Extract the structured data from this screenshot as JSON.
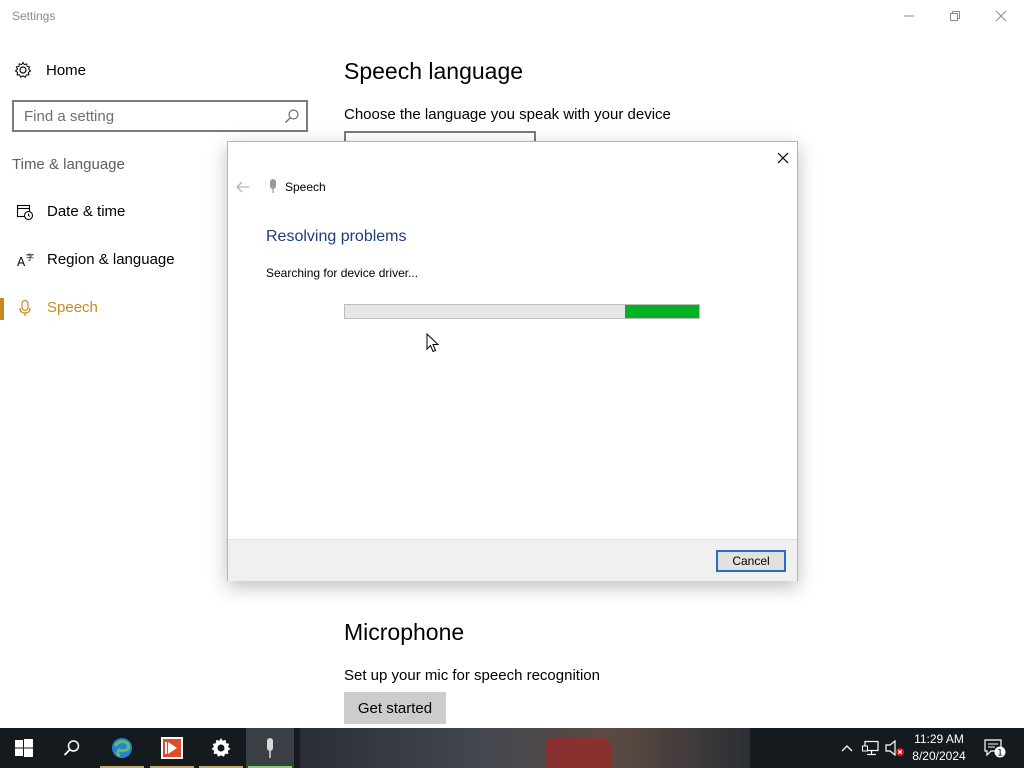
{
  "window": {
    "title": "Settings",
    "controls": [
      "minimize-icon",
      "restore-icon",
      "close-icon"
    ]
  },
  "sidebar": {
    "home_label": "Home",
    "search_placeholder": "Find a setting",
    "group_title": "Time & language",
    "items": [
      {
        "label": "Date & time",
        "icon": "calendar-clock-icon",
        "active": false
      },
      {
        "label": "Region & language",
        "icon": "language-icon",
        "active": false
      },
      {
        "label": "Speech",
        "icon": "microphone-icon",
        "active": true
      }
    ]
  },
  "main": {
    "speech_language_heading": "Speech language",
    "speech_language_desc": "Choose the language you speak with your device",
    "microphone_heading": "Microphone",
    "microphone_desc": "Set up your mic for speech recognition",
    "get_started_label": "Get started"
  },
  "dialog": {
    "app_name": "Speech",
    "heading": "Resolving problems",
    "status": "Searching for device driver...",
    "progress_indeterminate": true,
    "cancel_label": "Cancel"
  },
  "taskbar": {
    "apps": [
      "windows-start-icon",
      "search-icon",
      "browser-icon",
      "media-app-icon",
      "settings-gear-icon",
      "microphone-icon"
    ],
    "tray": [
      "chevron-up-icon",
      "network-icon",
      "volume-muted-icon",
      "action-center-icon"
    ],
    "time": "11:29 AM",
    "date": "8/20/2024",
    "notification_count": "1"
  },
  "colors": {
    "accent": "#c58a22",
    "progress": "#06b025",
    "dialog_heading": "#1f3d7a",
    "taskbar": "#151a1e"
  }
}
